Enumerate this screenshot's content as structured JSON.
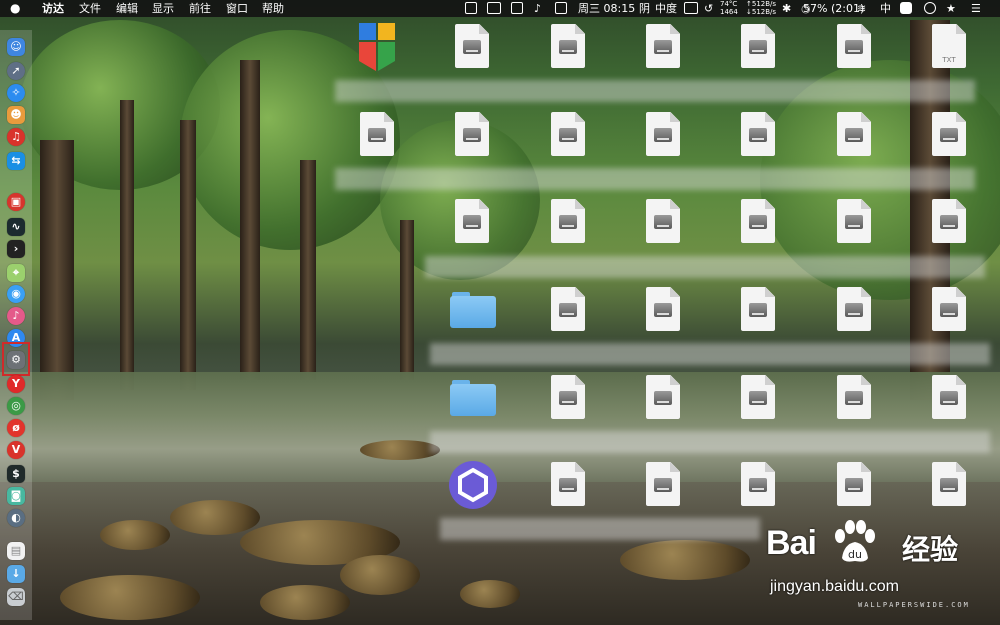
{
  "menubar": {
    "app_name": "访达",
    "menus": [
      "文件",
      "编辑",
      "显示",
      "前往",
      "窗口",
      "帮助"
    ],
    "status": {
      "clock": "周三 08:15",
      "weather": "阴",
      "input_method": "中度",
      "cpu_temp": "74°C",
      "fan_rpm": "1464",
      "net_up": "↑512B/s",
      "net_down": "↓512B/s",
      "battery": "57% (2:01)",
      "ime": "中"
    }
  },
  "desktop": {
    "file_ext_label": "TXT"
  },
  "watermark": {
    "brand": "Bai",
    "brand_cn": "经验",
    "url": "jingyan.baidu.com",
    "wallpaper_credit": "WALLPAPERSWIDE.COM"
  },
  "dock": {
    "icons": [
      "finder-icon",
      "launchpad-icon",
      "safari-icon",
      "contacts-icon",
      "netease-music-icon",
      "teamviewer-icon",
      "baidu-netdisk-icon",
      "activity-monitor-icon",
      "terminal-icon",
      "maps-icon",
      "qq-icon",
      "itunes-icon",
      "app-store-icon",
      "system-preferences-icon",
      "yandex-icon",
      "chrome-icon",
      "weibo-icon",
      "vivaldi-icon",
      "iterm-icon",
      "screenshot-icon",
      "migration-icon",
      "document-icon",
      "downloads-folder-icon",
      "trash-icon"
    ]
  }
}
